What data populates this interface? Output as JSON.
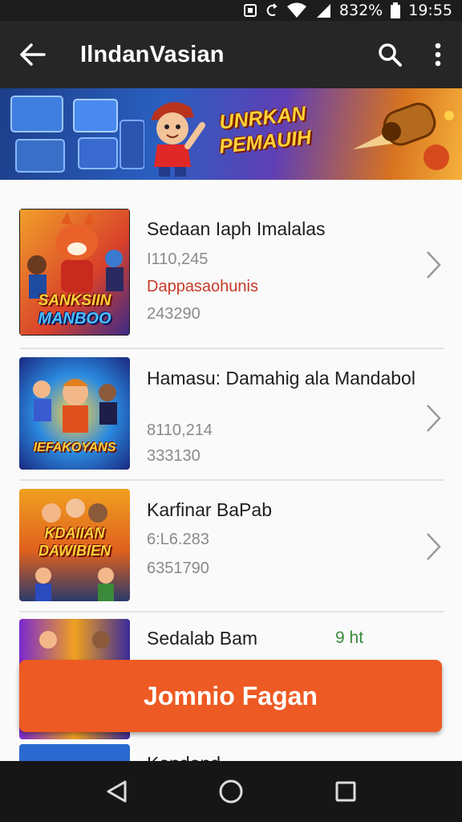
{
  "status_bar": {
    "battery_text": "832%",
    "time": "19:55"
  },
  "app_bar": {
    "title": "IlndanVasian"
  },
  "banner": {
    "headline_line1": "UNRKAN",
    "headline_line2": "PEMAUIH"
  },
  "items": [
    {
      "title": "Sedaan Iaph Imalalas",
      "line1": "I110,245",
      "line2": "Dappasaohunis",
      "line3": "243290",
      "thumb_label_top": "SANKSIIN",
      "thumb_label_bottom": "MANBOO"
    },
    {
      "title": "Hamasu: Damahig ala Mandabol",
      "line1": "8110,214",
      "line2": "333130",
      "thumb_label": "IEFAKOYANS"
    },
    {
      "title": "Karfinar BaPab",
      "line1": "6:L6.283",
      "line2": "6351790",
      "thumb_label_top": "KDAIIAN",
      "thumb_label_bottom": "DAWIBIEN"
    },
    {
      "title": "Sedalab Bam",
      "badge": "9 ht"
    },
    {
      "title": "Kendand"
    }
  ],
  "cta": {
    "label": "Jomnio Fagan"
  },
  "colors": {
    "app_bar": "#262626",
    "accent": "#ee5a23",
    "tag_red": "#c73a28",
    "badge_green": "#3a8a3a"
  },
  "icons": {
    "back": "arrow-left-icon",
    "search": "search-icon",
    "more": "more-vertical-icon",
    "nav_back": "triangle-back-icon",
    "nav_home": "circle-home-icon",
    "nav_recents": "square-recents-icon"
  }
}
